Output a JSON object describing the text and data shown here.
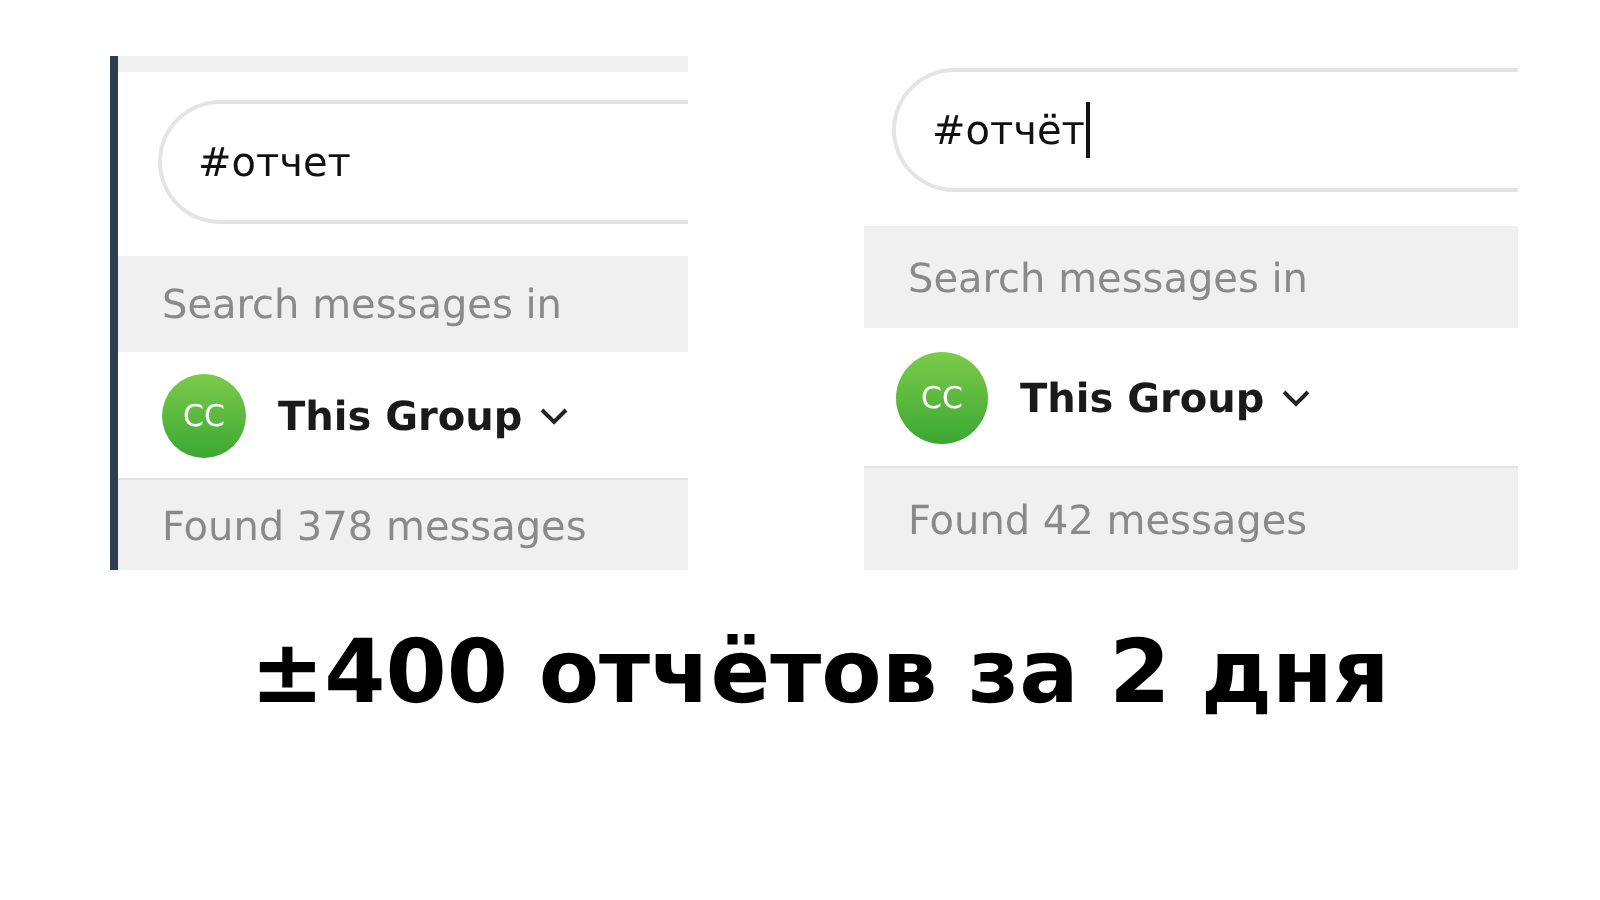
{
  "panels": [
    {
      "highlighted": true,
      "query": "#отчет",
      "focused": false,
      "scope_label": "Search messages in",
      "avatar": "CC",
      "group": "This Group",
      "result": "Found 378 messages"
    },
    {
      "highlighted": false,
      "query": "#отчёт",
      "focused": true,
      "scope_label": "Search messages in",
      "avatar": "CC",
      "group": "This Group",
      "result": "Found 42 messages"
    }
  ],
  "caption": "±400 отчётов за 2 дня"
}
